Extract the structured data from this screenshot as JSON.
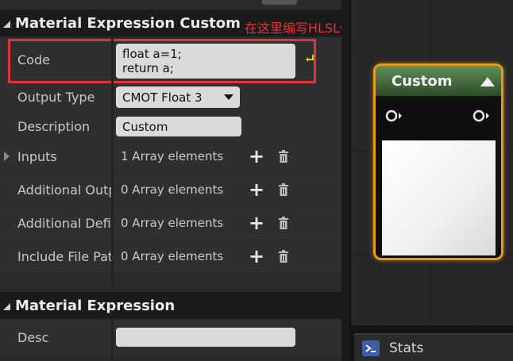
{
  "annotation": "在这里编写HLSL代码",
  "category_custom": {
    "title": "Material Expression Custom"
  },
  "rows": {
    "code": {
      "label": "Code",
      "line1": "float a=1;",
      "line2": "return a;"
    },
    "output_type": {
      "label": "Output Type",
      "value": "CMOT Float 3"
    },
    "description": {
      "label": "Description",
      "value": "Custom"
    },
    "inputs": {
      "label": "Inputs",
      "value": "1 Array elements"
    },
    "additional_outputs": {
      "label": "Additional Outputs",
      "value": "0 Array elements"
    },
    "additional_defines": {
      "label": "Additional Defines",
      "value": "0 Array elements"
    },
    "include_file_paths": {
      "label": "Include File Paths",
      "value": "0 Array elements"
    }
  },
  "category_expression": {
    "title": "Material Expression"
  },
  "desc_row": {
    "label": "Desc",
    "value": ""
  },
  "node": {
    "title": "Custom"
  },
  "stats_tab": {
    "label": "Stats"
  },
  "colors": {
    "highlight": "#e0333a",
    "node_border": "#e89a1d",
    "node_header": "#4f7b48",
    "reset_arrow": "#e3c51a"
  }
}
